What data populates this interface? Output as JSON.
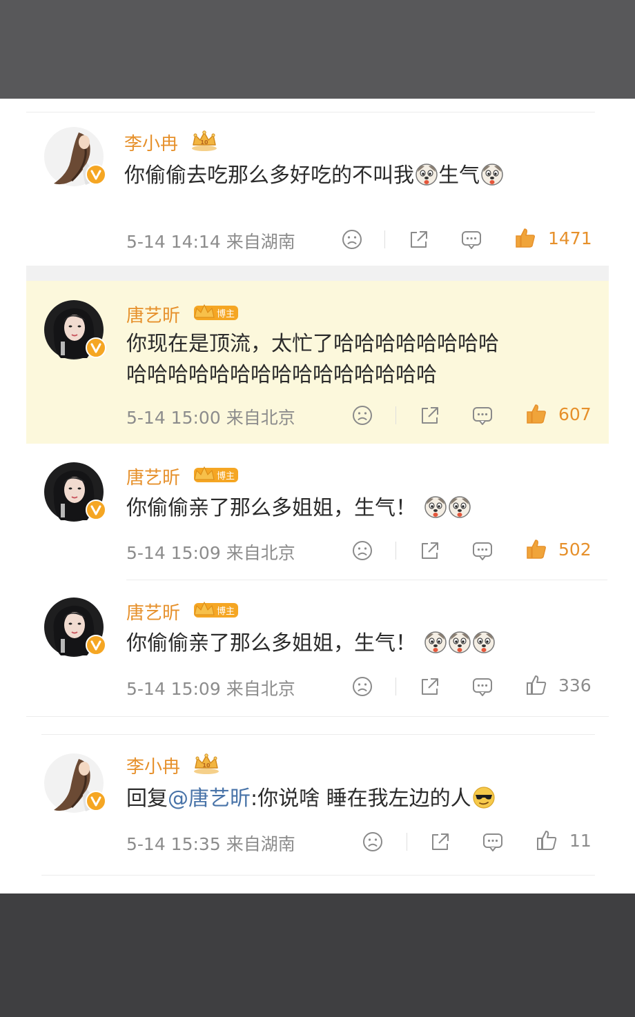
{
  "comments": [
    {
      "author": "李小冉",
      "badge": "crown",
      "text_parts": [
        "你偷偷去吃那么多好吃的不叫我",
        "生气"
      ],
      "emojis": [
        "doge",
        "doge"
      ],
      "time": "5-14 14:14",
      "location": "来自湖南",
      "likes": "1471"
    },
    {
      "author": "唐艺昕",
      "badge": "博主",
      "line1": "你现在是顶流，太忙了哈哈哈哈哈哈哈哈",
      "line2": "哈哈哈哈哈哈哈哈哈哈哈哈哈哈哈",
      "time": "5-14 15:00",
      "location": "来自北京",
      "likes": "607",
      "highlighted": true
    },
    {
      "author": "唐艺昕",
      "badge": "博主",
      "text": "你偷偷亲了那么多姐姐，生气！",
      "emojis": [
        "doge",
        "doge"
      ],
      "time": "5-14 15:09",
      "location": "来自北京",
      "likes": "502"
    },
    {
      "author": "唐艺昕",
      "badge": "博主",
      "text": "你偷偷亲了那么多姐姐，生气！",
      "emojis": [
        "doge",
        "doge",
        "doge"
      ],
      "time": "5-14 15:09",
      "location": "来自北京",
      "likes": "336"
    },
    {
      "author": "李小冉",
      "badge": "crown",
      "reply_prefix": "回复",
      "mention": "@唐艺昕",
      "text": ":你说啥 睡在我左边的人",
      "emojis": [
        "cool"
      ],
      "time": "5-14 15:35",
      "location": "来自湖南",
      "likes": "11"
    }
  ],
  "icons": [
    "sad-face-icon",
    "share-icon",
    "comment-icon",
    "thumbs-up-icon"
  ],
  "colors": {
    "name": "#e6902b",
    "likes_hot": "#e6902b",
    "mention": "#4873a8",
    "highlight_bg": "#fcf8dc"
  }
}
